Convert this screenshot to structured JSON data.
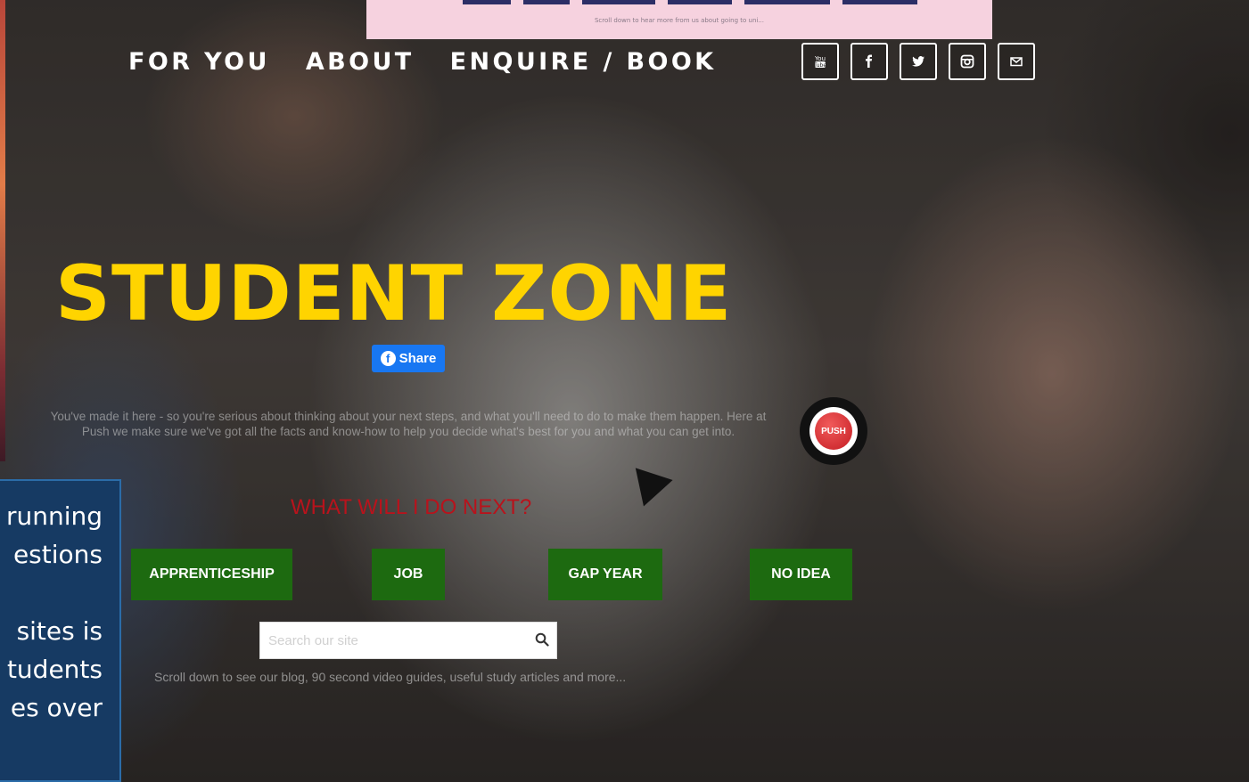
{
  "banner": {
    "text": "Scroll down to hear more from us about going to uni..."
  },
  "nav": {
    "items": [
      "FOR YOU",
      "ABOUT",
      "ENQUIRE / BOOK"
    ]
  },
  "social": {
    "icons": [
      "youtube-icon",
      "facebook-icon",
      "twitter-icon",
      "instagram-icon",
      "email-icon"
    ]
  },
  "hero": {
    "title": "STUDENT ZONE",
    "share_label": "Share",
    "intro_line1": "You've made it here - so you're serious about thinking about your next steps, and what you'll need to do to make them happen. Here at",
    "intro_line2": "Push we make sure we've got all the facts and know-how to help you decide what's best for you and what you can get into.",
    "badge_label": "PUSH"
  },
  "next": {
    "heading": "WHAT WILL I DO NEXT?",
    "buttons": [
      "APPRENTICESHIP",
      "JOB",
      "GAP YEAR",
      "NO IDEA"
    ]
  },
  "search": {
    "placeholder": "Search our site"
  },
  "scroll_note": "Scroll down to see our blog, 90 second video guides, useful study articles and more...",
  "side_panel": {
    "lines": [
      "running",
      "estions",
      "",
      "sites  is",
      "tudents",
      "es over"
    ]
  },
  "colors": {
    "title": "#ffd400",
    "cta_green": "#1d6a10",
    "heading_red": "#b8131c",
    "facebook_blue": "#1877f2"
  }
}
